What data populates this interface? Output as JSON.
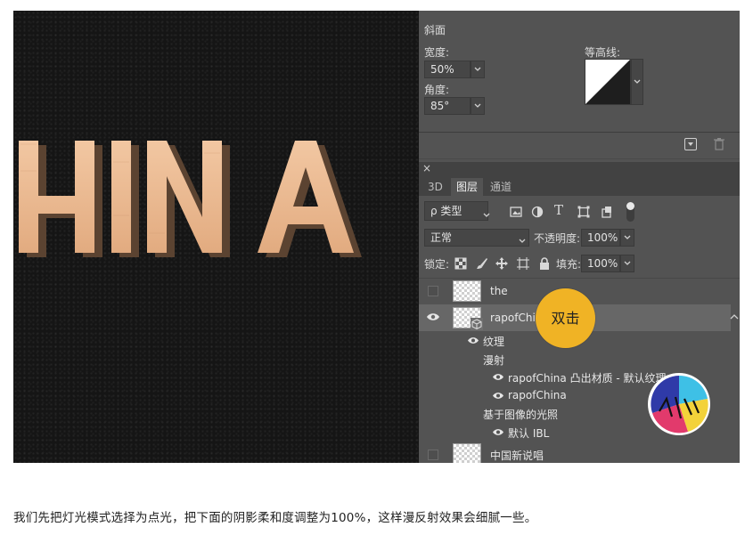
{
  "canvas": {
    "text": "HINA",
    "letter_color": "#e8b892",
    "shadow_color": "#5b4331"
  },
  "bevel": {
    "title": "斜面",
    "width_label": "宽度:",
    "width_value": "50%",
    "angle_label": "角度:",
    "angle_value": "85°",
    "contour_label": "等高线:"
  },
  "layers_panel": {
    "close_glyph": "×",
    "tabs": [
      {
        "label": "3D"
      },
      {
        "label": "图层"
      },
      {
        "label": "通道"
      }
    ],
    "active_tab": "图层",
    "filter_label": "ρ 类型",
    "blend_mode": "正常",
    "opacity_label": "不透明度:",
    "opacity_value": "100%",
    "lock_label": "锁定:",
    "fill_label": "填充:",
    "fill_value": "100%",
    "layers": [
      {
        "name": "the"
      },
      {
        "name": "rapofChina"
      },
      {
        "name": "纹理"
      },
      {
        "name": "漫射"
      },
      {
        "name": "rapofChina 凸出材质 - 默认纹理"
      },
      {
        "name": "rapofChina"
      },
      {
        "name": "基于图像的光照"
      },
      {
        "name": "默认 IBL"
      },
      {
        "name": "中国新说唱"
      }
    ]
  },
  "callout": {
    "text": "双击",
    "color": "#f0b325"
  },
  "caption": "我们先把灯光模式选择为点光，把下面的阴影柔和度调整为100%，这样漫反射效果会细腻一些。"
}
